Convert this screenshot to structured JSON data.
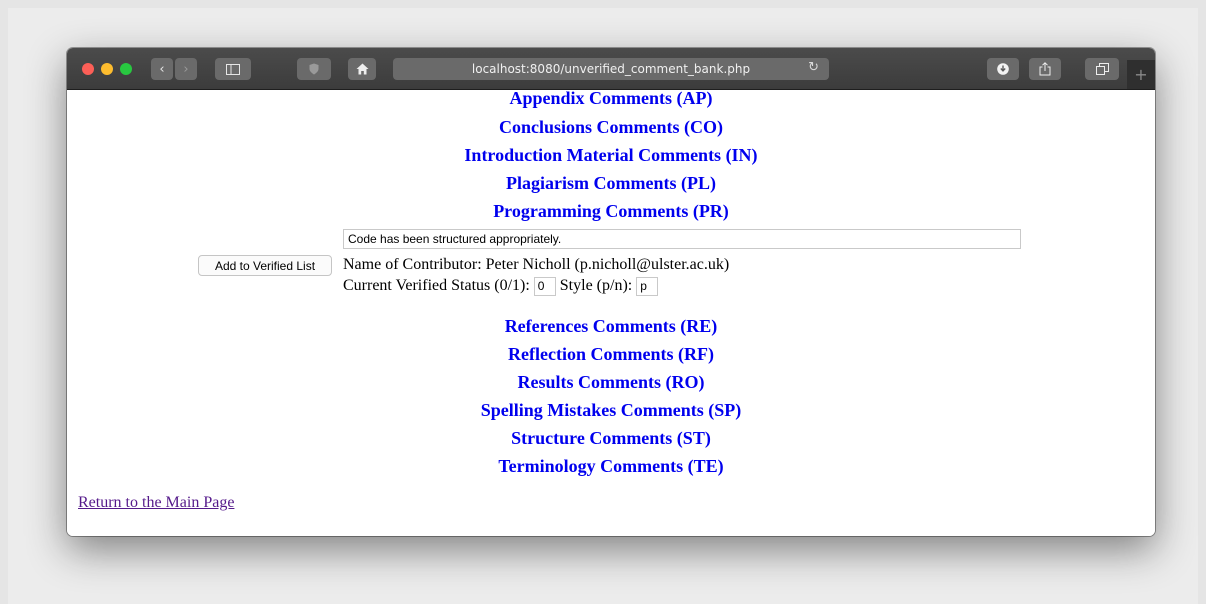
{
  "browser": {
    "url": "localhost:8080/unverified_comment_bank.php"
  },
  "categories_before": [
    "Appendix Comments (AP)",
    "Conclusions Comments (CO)",
    "Introduction Material Comments (IN)",
    "Plagiarism Comments (PL)",
    "Programming Comments (PR)"
  ],
  "comment": {
    "text": "Code has been structured appropriately.",
    "add_button_label": "Add to Verified List",
    "contributor_line": "Name of Contributor: Peter Nicholl (p.nicholl@ulster.ac.uk)",
    "status_label": "Current Verified Status (0/1):",
    "status_value": "0",
    "style_label": "Style (p/n):",
    "style_value": "p"
  },
  "categories_after": [
    "References Comments (RE)",
    "Reflection Comments (RF)",
    "Results Comments (RO)",
    "Spelling Mistakes Comments (SP)",
    "Structure Comments (ST)",
    "Terminology Comments (TE)"
  ],
  "footer": {
    "return_link": "Return to the Main Page"
  },
  "colors": {
    "link": "#0000ee",
    "visited_link": "#551a8b"
  }
}
